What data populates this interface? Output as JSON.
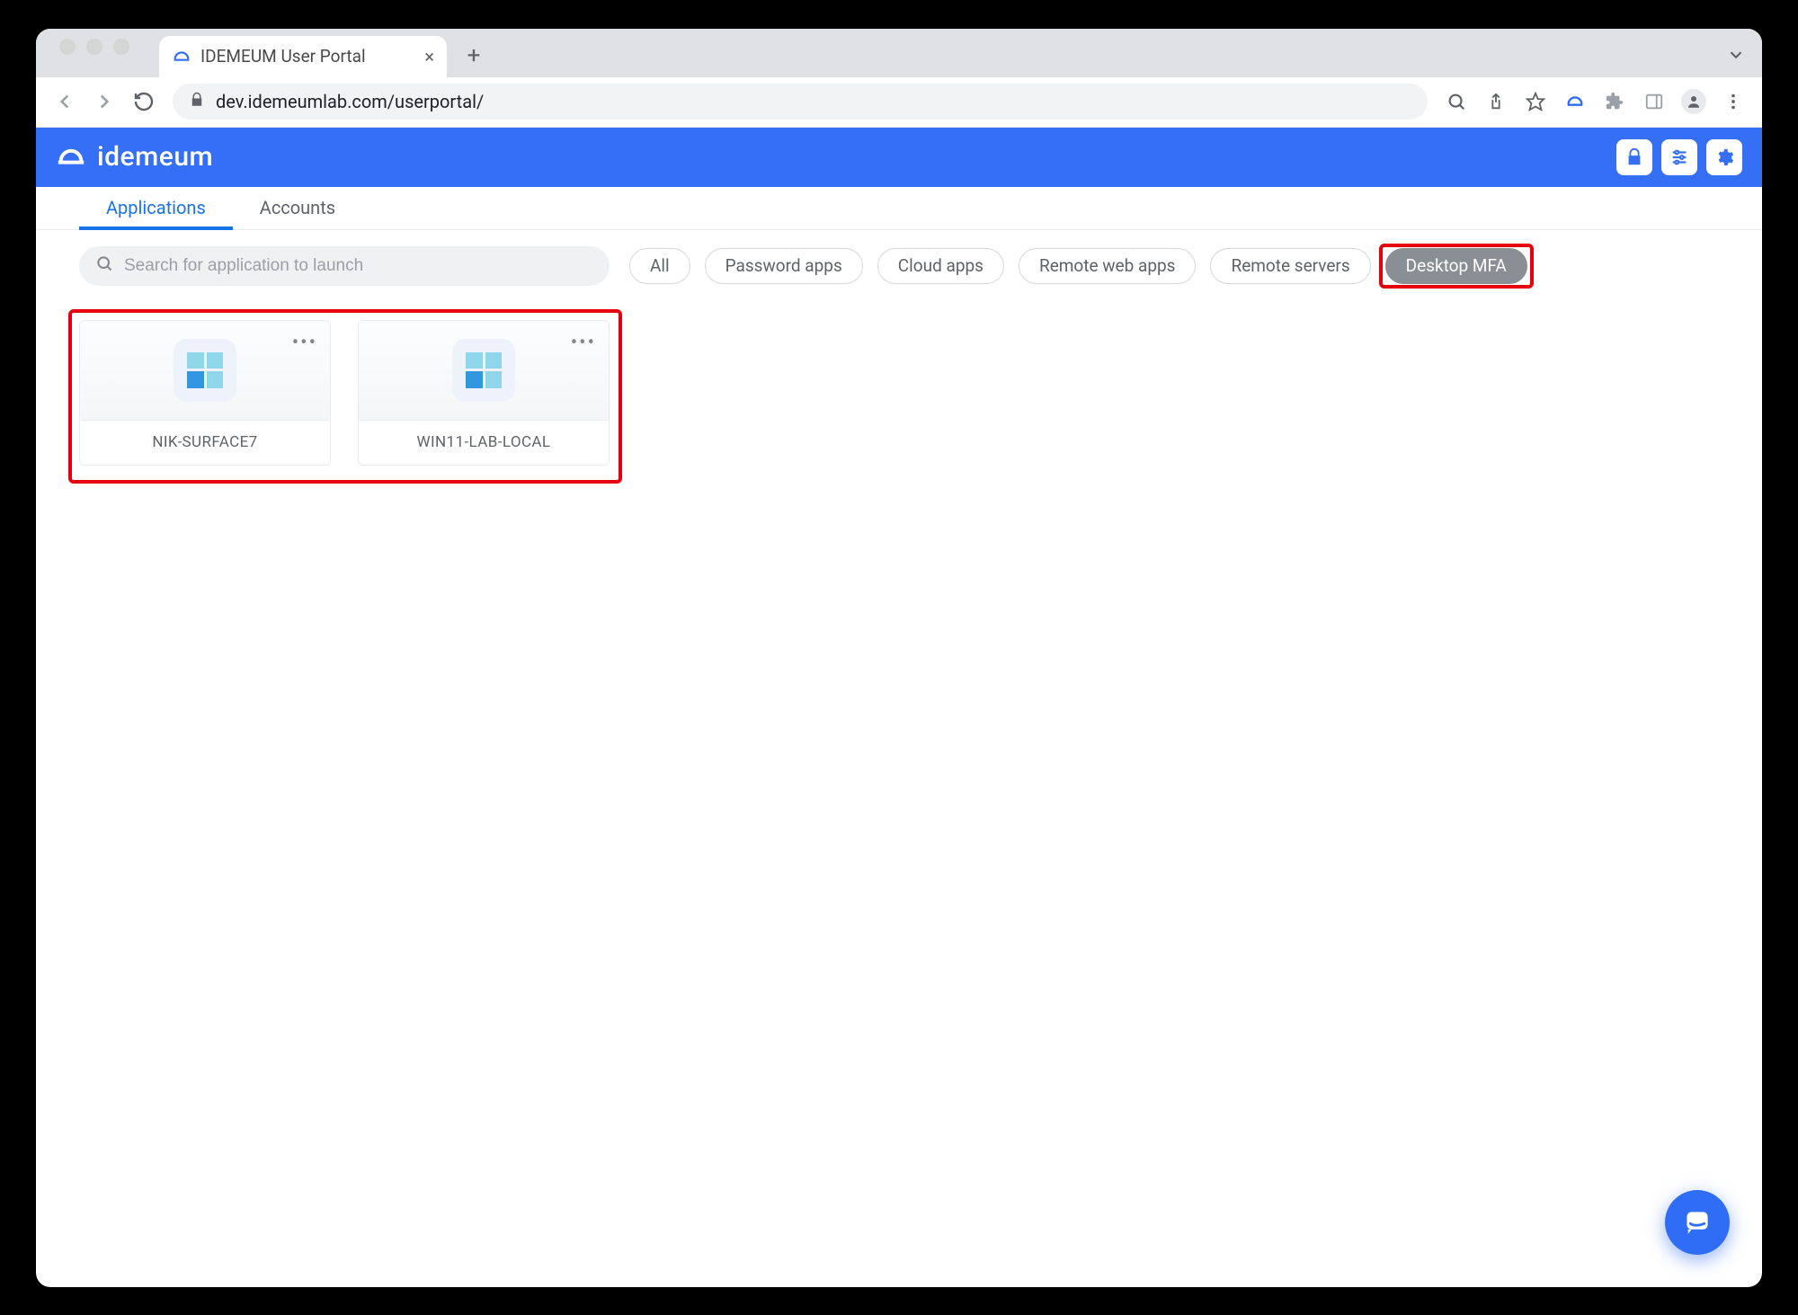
{
  "browser": {
    "tab_title": "IDEMEUM User Portal",
    "url": "dev.idemeumlab.com/userportal/"
  },
  "header": {
    "brand": "idemeum"
  },
  "tabs": [
    {
      "label": "Applications",
      "active": true
    },
    {
      "label": "Accounts",
      "active": false
    }
  ],
  "search": {
    "placeholder": "Search for application to launch"
  },
  "filters": [
    {
      "label": "All",
      "selected": false
    },
    {
      "label": "Password apps",
      "selected": false
    },
    {
      "label": "Cloud apps",
      "selected": false
    },
    {
      "label": "Remote web apps",
      "selected": false
    },
    {
      "label": "Remote servers",
      "selected": false
    },
    {
      "label": "Desktop MFA",
      "selected": true
    }
  ],
  "cards": [
    {
      "name": "NIK-SURFACE7"
    },
    {
      "name": "WIN11-LAB-LOCAL"
    }
  ]
}
